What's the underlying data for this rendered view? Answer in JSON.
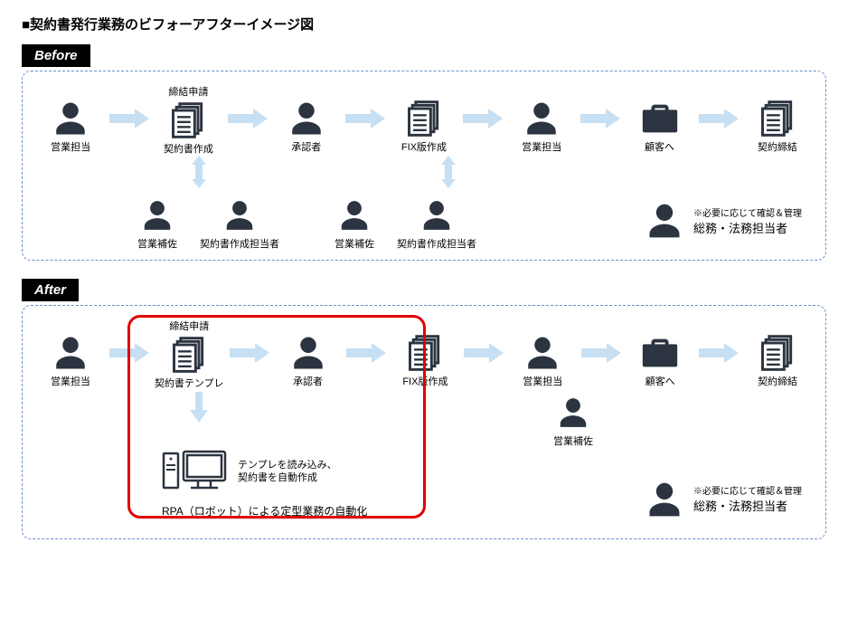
{
  "title": "■契約書発行業務のビフォーアフターイメージ図",
  "sections": {
    "before": {
      "label": "Before",
      "flow": [
        {
          "role": "営業担当"
        },
        {
          "doc": "契約書作成",
          "above": "締結申請"
        },
        {
          "role": "承認者"
        },
        {
          "doc": "FIX版作成"
        },
        {
          "role": "営業担当"
        },
        {
          "brief": "顧客へ"
        },
        {
          "doc": "契約締結"
        }
      ],
      "subA": [
        "営業補佐",
        "契約書作成担当者"
      ],
      "subB": [
        "営業補佐",
        "契約書作成担当者"
      ],
      "note": {
        "small": "※必要に応じて確認＆管理",
        "big": "総務・法務担当者"
      }
    },
    "after": {
      "label": "After",
      "flow": [
        {
          "role": "営業担当"
        },
        {
          "doc": "契約書テンプレ",
          "above": "締結申請"
        },
        {
          "role": "承認者"
        },
        {
          "doc": "FIX版作成"
        },
        {
          "role": "営業担当"
        },
        {
          "brief": "顧客へ"
        },
        {
          "doc": "契約締結"
        }
      ],
      "rpa": {
        "computer_note": "テンプレを読み込み、\n契約書を自動作成",
        "caption": "RPA（ロボット）による定型業務の自動化"
      },
      "sub_assist": "営業補佐",
      "note": {
        "small": "※必要に応じて確認＆管理",
        "big": "総務・法務担当者"
      }
    }
  }
}
